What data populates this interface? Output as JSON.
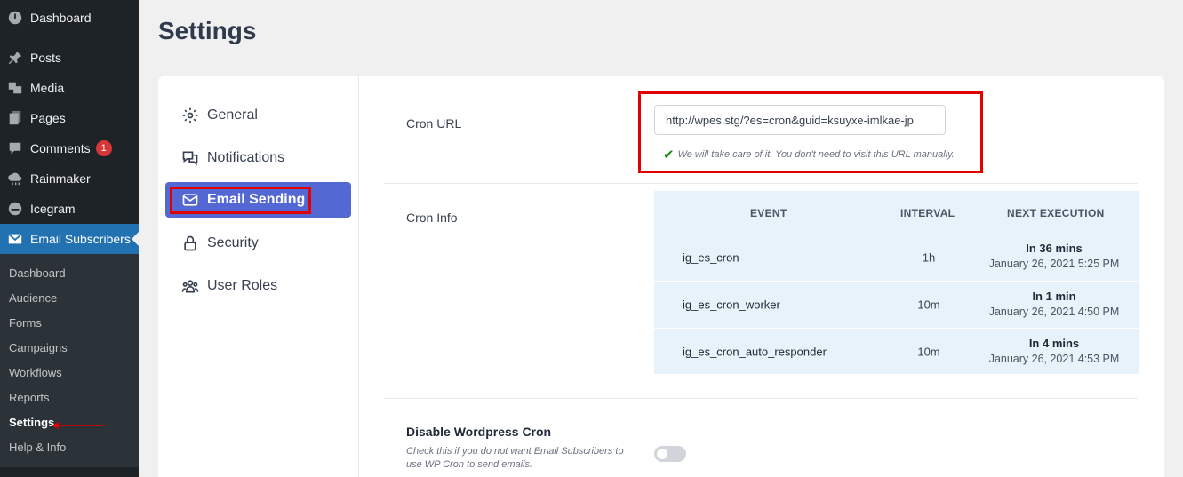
{
  "admin_menu": {
    "items": [
      {
        "label": "Dashboard",
        "icon": "dashboard-icon"
      },
      {
        "label": "Posts",
        "icon": "pin-icon"
      },
      {
        "label": "Media",
        "icon": "media-icon"
      },
      {
        "label": "Pages",
        "icon": "pages-icon"
      },
      {
        "label": "Comments",
        "icon": "comments-icon",
        "badge": "1"
      },
      {
        "label": "Rainmaker",
        "icon": "cloud-icon"
      },
      {
        "label": "Icegram",
        "icon": "icegram-icon"
      },
      {
        "label": "Email Subscribers",
        "icon": "envelope-icon"
      }
    ],
    "submenu": [
      "Dashboard",
      "Audience",
      "Forms",
      "Campaigns",
      "Workflows",
      "Reports",
      "Settings",
      "Help & Info"
    ]
  },
  "page": {
    "title": "Settings"
  },
  "tabs": [
    {
      "label": "General",
      "icon": "gear-icon"
    },
    {
      "label": "Notifications",
      "icon": "chat-icon"
    },
    {
      "label": "Email Sending",
      "icon": "envelope-icon"
    },
    {
      "label": "Security",
      "icon": "lock-icon"
    },
    {
      "label": "User Roles",
      "icon": "users-icon"
    }
  ],
  "cron_url": {
    "label": "Cron URL",
    "value": "http://wpes.stg/?es=cron&guid=ksuyxe-imlkae-jp",
    "note": "We will take care of it. You don't need to visit this URL manually."
  },
  "cron_info": {
    "label": "Cron Info",
    "headers": [
      "EVENT",
      "INTERVAL",
      "NEXT EXECUTION"
    ],
    "rows": [
      {
        "event": "ig_es_cron",
        "interval": "1h",
        "next": "In 36 mins",
        "date": "January 26, 2021 5:25 PM"
      },
      {
        "event": "ig_es_cron_worker",
        "interval": "10m",
        "next": "In 1 min",
        "date": "January 26, 2021 4:50 PM"
      },
      {
        "event": "ig_es_cron_auto_responder",
        "interval": "10m",
        "next": "In 4 mins",
        "date": "January 26, 2021 4:53 PM"
      }
    ]
  },
  "disable_cron": {
    "label": "Disable Wordpress Cron",
    "description": "Check this if you do not want Email Subscribers to use WP Cron to send emails.",
    "enabled": false
  },
  "colors": {
    "accent": "#5468d4",
    "admin_blue": "#2271b1",
    "highlight": "#e00000"
  }
}
